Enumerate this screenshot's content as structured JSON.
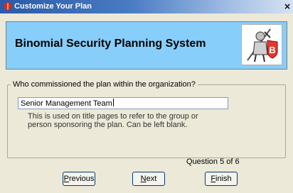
{
  "window": {
    "title": "Customize Your Plan",
    "close_symbol": "×"
  },
  "header": {
    "title": "Binomial Security Planning System",
    "logo_letter": "B"
  },
  "question": {
    "prompt": "Who commissioned the plan within the organization?",
    "value": "Senior Management Team",
    "help_text": "This is used on title pages to refer to the group or person sponsoring the plan. Can be left blank.",
    "counter": "Question 5 of 6"
  },
  "buttons": {
    "previous": {
      "mnemonic": "P",
      "rest": "revious"
    },
    "next": {
      "mnemonic": "N",
      "rest": "ext"
    },
    "finish": {
      "mnemonic": "F",
      "rest": "inish"
    }
  },
  "colors": {
    "header_bg": "#87cefa",
    "titlebar_start": "#2a5aa8",
    "logo_badge": "#e8362c"
  }
}
